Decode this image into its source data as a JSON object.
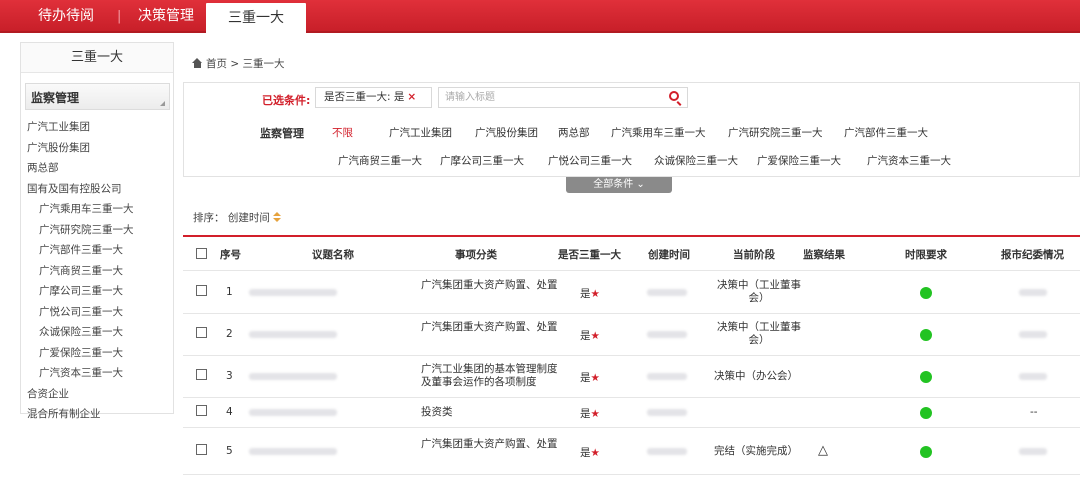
{
  "topnav": {
    "tab1": "待办待阅",
    "tab2": "决策管理",
    "tab_active": "三重一大"
  },
  "sidebar": {
    "title": "三重一大",
    "group_label": "监察管理",
    "items": [
      {
        "label": "广汽工业集团",
        "sub": false
      },
      {
        "label": "广汽股份集团",
        "sub": false
      },
      {
        "label": "两总部",
        "sub": false
      },
      {
        "label": "国有及国有控股公司",
        "sub": false
      },
      {
        "label": "广汽乘用车三重一大",
        "sub": true
      },
      {
        "label": "广汽研究院三重一大",
        "sub": true
      },
      {
        "label": "广汽部件三重一大",
        "sub": true
      },
      {
        "label": "广汽商贸三重一大",
        "sub": true
      },
      {
        "label": "广摩公司三重一大",
        "sub": true
      },
      {
        "label": "广悦公司三重一大",
        "sub": true
      },
      {
        "label": "众诚保险三重一大",
        "sub": true
      },
      {
        "label": "广爱保险三重一大",
        "sub": true
      },
      {
        "label": "广汽资本三重一大",
        "sub": true
      },
      {
        "label": "合资企业",
        "sub": false
      },
      {
        "label": "混合所有制企业",
        "sub": false
      }
    ]
  },
  "breadcrumb": {
    "home": "首页",
    "sep": ">",
    "current": "三重一大"
  },
  "filter": {
    "selected_label": "已选条件:",
    "selected_tag": "是否三重一大: 是",
    "remove_icon": "×",
    "search_placeholder": "请输入标题",
    "category_label": "监察管理",
    "categories": [
      "不限",
      "广汽工业集团",
      "广汽股份集团",
      "两总部",
      "广汽乘用车三重一大",
      "广汽研究院三重一大",
      "广汽部件三重一大",
      "广汽商贸三重一大",
      "广摩公司三重一大",
      "广悦公司三重一大",
      "众诚保险三重一大",
      "广爱保险三重一大",
      "广汽资本三重一大"
    ],
    "all_conditions": "全部条件 ⌄"
  },
  "sort": {
    "label": "排序：",
    "field": "创建时间"
  },
  "table": {
    "headers": {
      "seq": "序号",
      "topic": "议题名称",
      "category": "事项分类",
      "is_major": "是否三重一大",
      "created": "创建时间",
      "stage": "当前阶段",
      "result": "监察结果",
      "deadline": "时限要求",
      "report": "报市纪委情况"
    },
    "rows": [
      {
        "seq": "1",
        "category": "广汽集团重大资产购置、处置",
        "is_major": "是",
        "stage": "决策中（工业董事会）",
        "result": "",
        "deadline": "green",
        "report": ""
      },
      {
        "seq": "2",
        "category": "广汽集团重大资产购置、处置",
        "is_major": "是",
        "stage": "决策中（工业董事会）",
        "result": "",
        "deadline": "green",
        "report": ""
      },
      {
        "seq": "3",
        "category": "广汽工业集团的基本管理制度及董事会运作的各项制度",
        "is_major": "是",
        "stage": "决策中（办公会）",
        "result": "",
        "deadline": "green",
        "report": ""
      },
      {
        "seq": "4",
        "category": "投资类",
        "is_major": "是",
        "stage": "",
        "result": "",
        "deadline": "green",
        "report": "--"
      },
      {
        "seq": "5",
        "category": "广汽集团重大资产购置、处置",
        "is_major": "是",
        "stage": "完结（实施完成）",
        "result": "△",
        "deadline": "green",
        "report": ""
      }
    ],
    "star": "★"
  },
  "colors": {
    "brand_red": "#d21f2a",
    "status_green": "#22c322"
  }
}
